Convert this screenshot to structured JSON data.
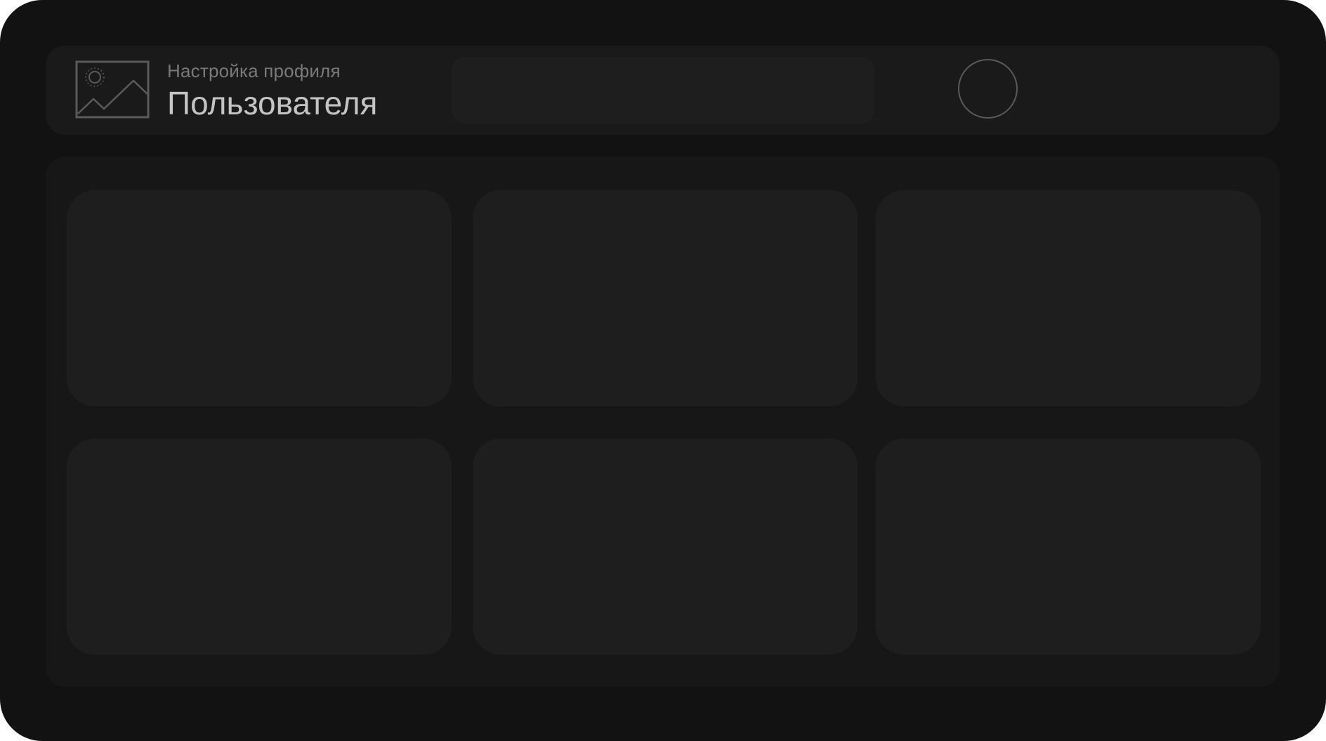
{
  "header": {
    "subtitle": "Настройка профиля",
    "title": "Пользователя",
    "logo_icon": "image-placeholder-icon",
    "avatar_icon": "avatar-circle"
  },
  "content": {
    "cards": [
      {
        "label": ""
      },
      {
        "label": ""
      },
      {
        "label": ""
      },
      {
        "label": ""
      },
      {
        "label": ""
      },
      {
        "label": ""
      }
    ]
  },
  "colors": {
    "background": "#121212",
    "panel": "#1a1a1a",
    "card": "#1e1e1e",
    "subtitle": "#7a7a7a",
    "title": "#c4c4c4",
    "outline": "#5a5a5a"
  }
}
